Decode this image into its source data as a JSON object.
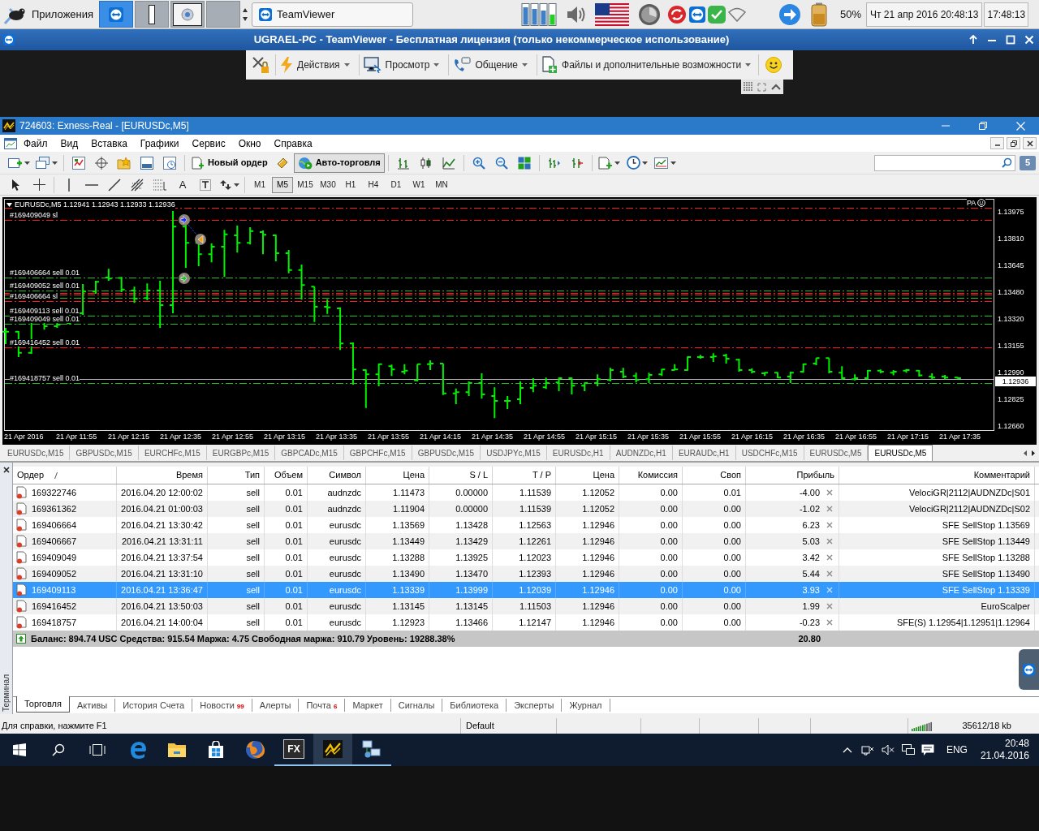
{
  "desktop_panel": {
    "apps_label": "Приложения",
    "workspaces": [
      {
        "kind": "teamviewer",
        "selected": true
      },
      {
        "kind": "window",
        "selected": false
      },
      {
        "kind": "browser",
        "selected": false
      },
      {
        "kind": "empty",
        "selected": false
      }
    ],
    "task": "TeamViewer",
    "battery": "50%",
    "date": "Чт 21 апр 2016 20:48:13",
    "clock": "17:48:13"
  },
  "remote_window": {
    "title": "UGRAEL-PC - TeamViewer - Бесплатная лицензия (только некоммерческое использование)",
    "menus": [
      {
        "label": "Действия",
        "kind": "actions"
      },
      {
        "label": "Просмотр",
        "kind": "view"
      },
      {
        "label": "Общение",
        "kind": "communicate"
      },
      {
        "label": "Файлы и дополнительные возможности",
        "kind": "files"
      }
    ]
  },
  "window": {
    "title": "724603: Exness-Real - [EURUSDc,M5]"
  },
  "menu": [
    "Файл",
    "Вид",
    "Вставка",
    "Графики",
    "Сервис",
    "Окно",
    "Справка"
  ],
  "toolbar": {
    "new_order": "Новый ордер",
    "auto_trading": {
      "label": "Авто-торговля",
      "on": true
    },
    "notifications": "5",
    "text_tool": "A",
    "timeframes": [
      {
        "label": "M1",
        "selected": false
      },
      {
        "label": "M5",
        "selected": true
      },
      {
        "label": "M15",
        "selected": false
      },
      {
        "label": "M30",
        "selected": false
      },
      {
        "label": "H1",
        "selected": false
      },
      {
        "label": "H4",
        "selected": false
      },
      {
        "label": "D1",
        "selected": false
      },
      {
        "label": "W1",
        "selected": false
      },
      {
        "label": "MN",
        "selected": false
      }
    ]
  },
  "chart": {
    "header": "EURUSDc,M5 1.12941 1.12943 1.12933 1.12936",
    "indicator": "PA",
    "levels": [
      {
        "kind": "stop"
      },
      {
        "kind": "stop",
        "label": "#169409049 sl"
      },
      {
        "kind": "entry",
        "label": "#169406664 sell 0.01"
      },
      {
        "kind": "entry",
        "label": "#169409052 sell 0.01"
      },
      {
        "kind": "stop"
      },
      {
        "kind": "stop"
      },
      {
        "kind": "entry"
      },
      {
        "kind": "stop",
        "label": "#169406664 sl"
      },
      {
        "kind": "entry",
        "label": "#169409113 sell 0.01"
      },
      {
        "kind": "entry",
        "label": "#169409049 sell 0.01"
      },
      {
        "kind": "stop",
        "label": "#169416452 sell 0.01"
      },
      {
        "kind": "entry",
        "label": "#169418757 sell 0.01"
      }
    ],
    "price_labels": [
      "1.13975",
      "1.13810",
      "1.13645",
      "1.13480",
      "1.13320",
      "1.13155",
      "1.12990",
      "1.12825",
      "1.12660"
    ],
    "current_price": "1.12936",
    "time_labels": [
      "21 Apr 2016",
      "21 Apr 11:55",
      "21 Apr 12:15",
      "21 Apr 12:35",
      "21 Apr 12:55",
      "21 Apr 13:15",
      "21 Apr 13:35",
      "21 Apr 13:55",
      "21 Apr 14:15",
      "21 Apr 14:35",
      "21 Apr 14:55",
      "21 Apr 15:15",
      "21 Apr 15:35",
      "21 Apr 15:55",
      "21 Apr 16:15",
      "21 Apr 16:35",
      "21 Apr 16:55",
      "21 Apr 17:15",
      "21 Apr 17:35"
    ]
  },
  "chart_tabs": [
    {
      "label": "EURUSDc,M15",
      "selected": false
    },
    {
      "label": "GBPUSDc,M15",
      "selected": false
    },
    {
      "label": "EURCHFc,M15",
      "selected": false
    },
    {
      "label": "EURGBPc,M15",
      "selected": false
    },
    {
      "label": "GBPCADc,M15",
      "selected": false
    },
    {
      "label": "GBPCHFc,M15",
      "selected": false
    },
    {
      "label": "GBPUSDc,M15",
      "selected": false
    },
    {
      "label": "USDJPYc,M15",
      "selected": false
    },
    {
      "label": "EURUSDc,H1",
      "selected": false
    },
    {
      "label": "AUDNZDc,H1",
      "selected": false
    },
    {
      "label": "EURAUDc,H1",
      "selected": false
    },
    {
      "label": "USDCHFc,M15",
      "selected": false
    },
    {
      "label": "EURUSDc,M5",
      "selected": false
    },
    {
      "label": "EURUSDc,M5",
      "selected": true
    }
  ],
  "terminal": {
    "side_label": "Терминал",
    "columns": [
      {
        "label": "Ордер",
        "sorted": true
      },
      {
        "label": "Время",
        "sorted": false
      },
      {
        "label": "Тип",
        "sorted": false
      },
      {
        "label": "Объем",
        "sorted": false
      },
      {
        "label": "Символ",
        "sorted": false
      },
      {
        "label": "Цена",
        "sorted": false
      },
      {
        "label": "S / L",
        "sorted": false
      },
      {
        "label": "T / P",
        "sorted": false
      },
      {
        "label": "Цена",
        "sorted": false
      },
      {
        "label": "Комиссия",
        "sorted": false
      },
      {
        "label": "Своп",
        "sorted": false
      },
      {
        "label": "Прибыль",
        "sorted": false
      },
      {
        "label": "Комментарий",
        "sorted": false
      }
    ],
    "rows": [
      {
        "selected": false,
        "cells": [
          "169322746",
          "2016.04.20 12:00:02",
          "sell",
          "0.01",
          "audnzdc",
          "1.11473",
          "0.00000",
          "1.11539",
          "1.12052",
          "0.00",
          "0.01",
          "-4.00",
          "VelociGR|2112|AUDNZDc|S01"
        ]
      },
      {
        "selected": false,
        "cells": [
          "169361362",
          "2016.04.21 01:00:03",
          "sell",
          "0.01",
          "audnzdc",
          "1.11904",
          "0.00000",
          "1.11539",
          "1.12052",
          "0.00",
          "0.00",
          "-1.02",
          "VelociGR|2112|AUDNZDc|S02"
        ]
      },
      {
        "selected": false,
        "cells": [
          "169406664",
          "2016.04.21 13:30:42",
          "sell",
          "0.01",
          "eurusdc",
          "1.13569",
          "1.13428",
          "1.12563",
          "1.12946",
          "0.00",
          "0.00",
          "6.23",
          "SFE SellStop 1.13569"
        ]
      },
      {
        "selected": false,
        "cells": [
          "169406667",
          "2016.04.21 13:31:11",
          "sell",
          "0.01",
          "eurusdc",
          "1.13449",
          "1.13429",
          "1.12261",
          "1.12946",
          "0.00",
          "0.00",
          "5.03",
          "SFE SellStop 1.13449"
        ]
      },
      {
        "selected": false,
        "cells": [
          "169409049",
          "2016.04.21 13:37:54",
          "sell",
          "0.01",
          "eurusdc",
          "1.13288",
          "1.13925",
          "1.12023",
          "1.12946",
          "0.00",
          "0.00",
          "3.42",
          "SFE SellStop 1.13288"
        ]
      },
      {
        "selected": false,
        "cells": [
          "169409052",
          "2016.04.21 13:31:10",
          "sell",
          "0.01",
          "eurusdc",
          "1.13490",
          "1.13470",
          "1.12393",
          "1.12946",
          "0.00",
          "0.00",
          "5.44",
          "SFE SellStop 1.13490"
        ]
      },
      {
        "selected": true,
        "cells": [
          "169409113",
          "2016.04.21 13:36:47",
          "sell",
          "0.01",
          "eurusdc",
          "1.13339",
          "1.13999",
          "1.12039",
          "1.12946",
          "0.00",
          "0.00",
          "3.93",
          "SFE SellStop 1.13339"
        ]
      },
      {
        "selected": false,
        "cells": [
          "169416452",
          "2016.04.21 13:50:03",
          "sell",
          "0.01",
          "eurusdc",
          "1.13145",
          "1.13145",
          "1.11503",
          "1.12946",
          "0.00",
          "0.00",
          "1.99",
          "EuroScalper"
        ]
      },
      {
        "selected": false,
        "cells": [
          "169418757",
          "2016.04.21 14:00:04",
          "sell",
          "0.01",
          "eurusdc",
          "1.12923",
          "1.13466",
          "1.12147",
          "1.12946",
          "0.00",
          "0.00",
          "-0.23",
          "SFE(S) 1.12954|1.12951|1.12964"
        ]
      }
    ],
    "summary": {
      "text": "Баланс: 894.74 USC Средства: 915.54 Маржа: 4.75 Свободная маржа: 910.79 Уровень: 19288.38%",
      "profit": "20.80"
    },
    "tabs": [
      {
        "label": "Торговля",
        "selected": true
      },
      {
        "label": "Активы",
        "selected": false
      },
      {
        "label": "История Счета",
        "selected": false
      },
      {
        "label": "Новости",
        "badge": "99",
        "selected": false
      },
      {
        "label": "Алерты",
        "selected": false
      },
      {
        "label": "Почта",
        "badge": "6",
        "selected": false
      },
      {
        "label": "Маркет",
        "selected": false
      },
      {
        "label": "Сигналы",
        "selected": false
      },
      {
        "label": "Библиотека",
        "selected": false
      },
      {
        "label": "Эксперты",
        "selected": false
      },
      {
        "label": "Журнал",
        "selected": false
      }
    ]
  },
  "status_bar": {
    "help": "Для справки, нажмите F1",
    "profile": "Default",
    "traffic": "35612/18 kb"
  },
  "taskbar": {
    "apps": [
      {
        "kind": "edge",
        "running": false,
        "active": false
      },
      {
        "kind": "explorer",
        "running": false,
        "active": false
      },
      {
        "kind": "store",
        "running": false,
        "active": false
      },
      {
        "kind": "firefox",
        "running": false,
        "active": false
      },
      {
        "kind": "fx",
        "label": "FX",
        "running": true,
        "active": false
      },
      {
        "kind": "terminal",
        "running": true,
        "active": true
      },
      {
        "kind": "network",
        "running": true,
        "active": false
      }
    ],
    "language": "ENG",
    "time": "20:48",
    "date": "21.04.2016"
  }
}
